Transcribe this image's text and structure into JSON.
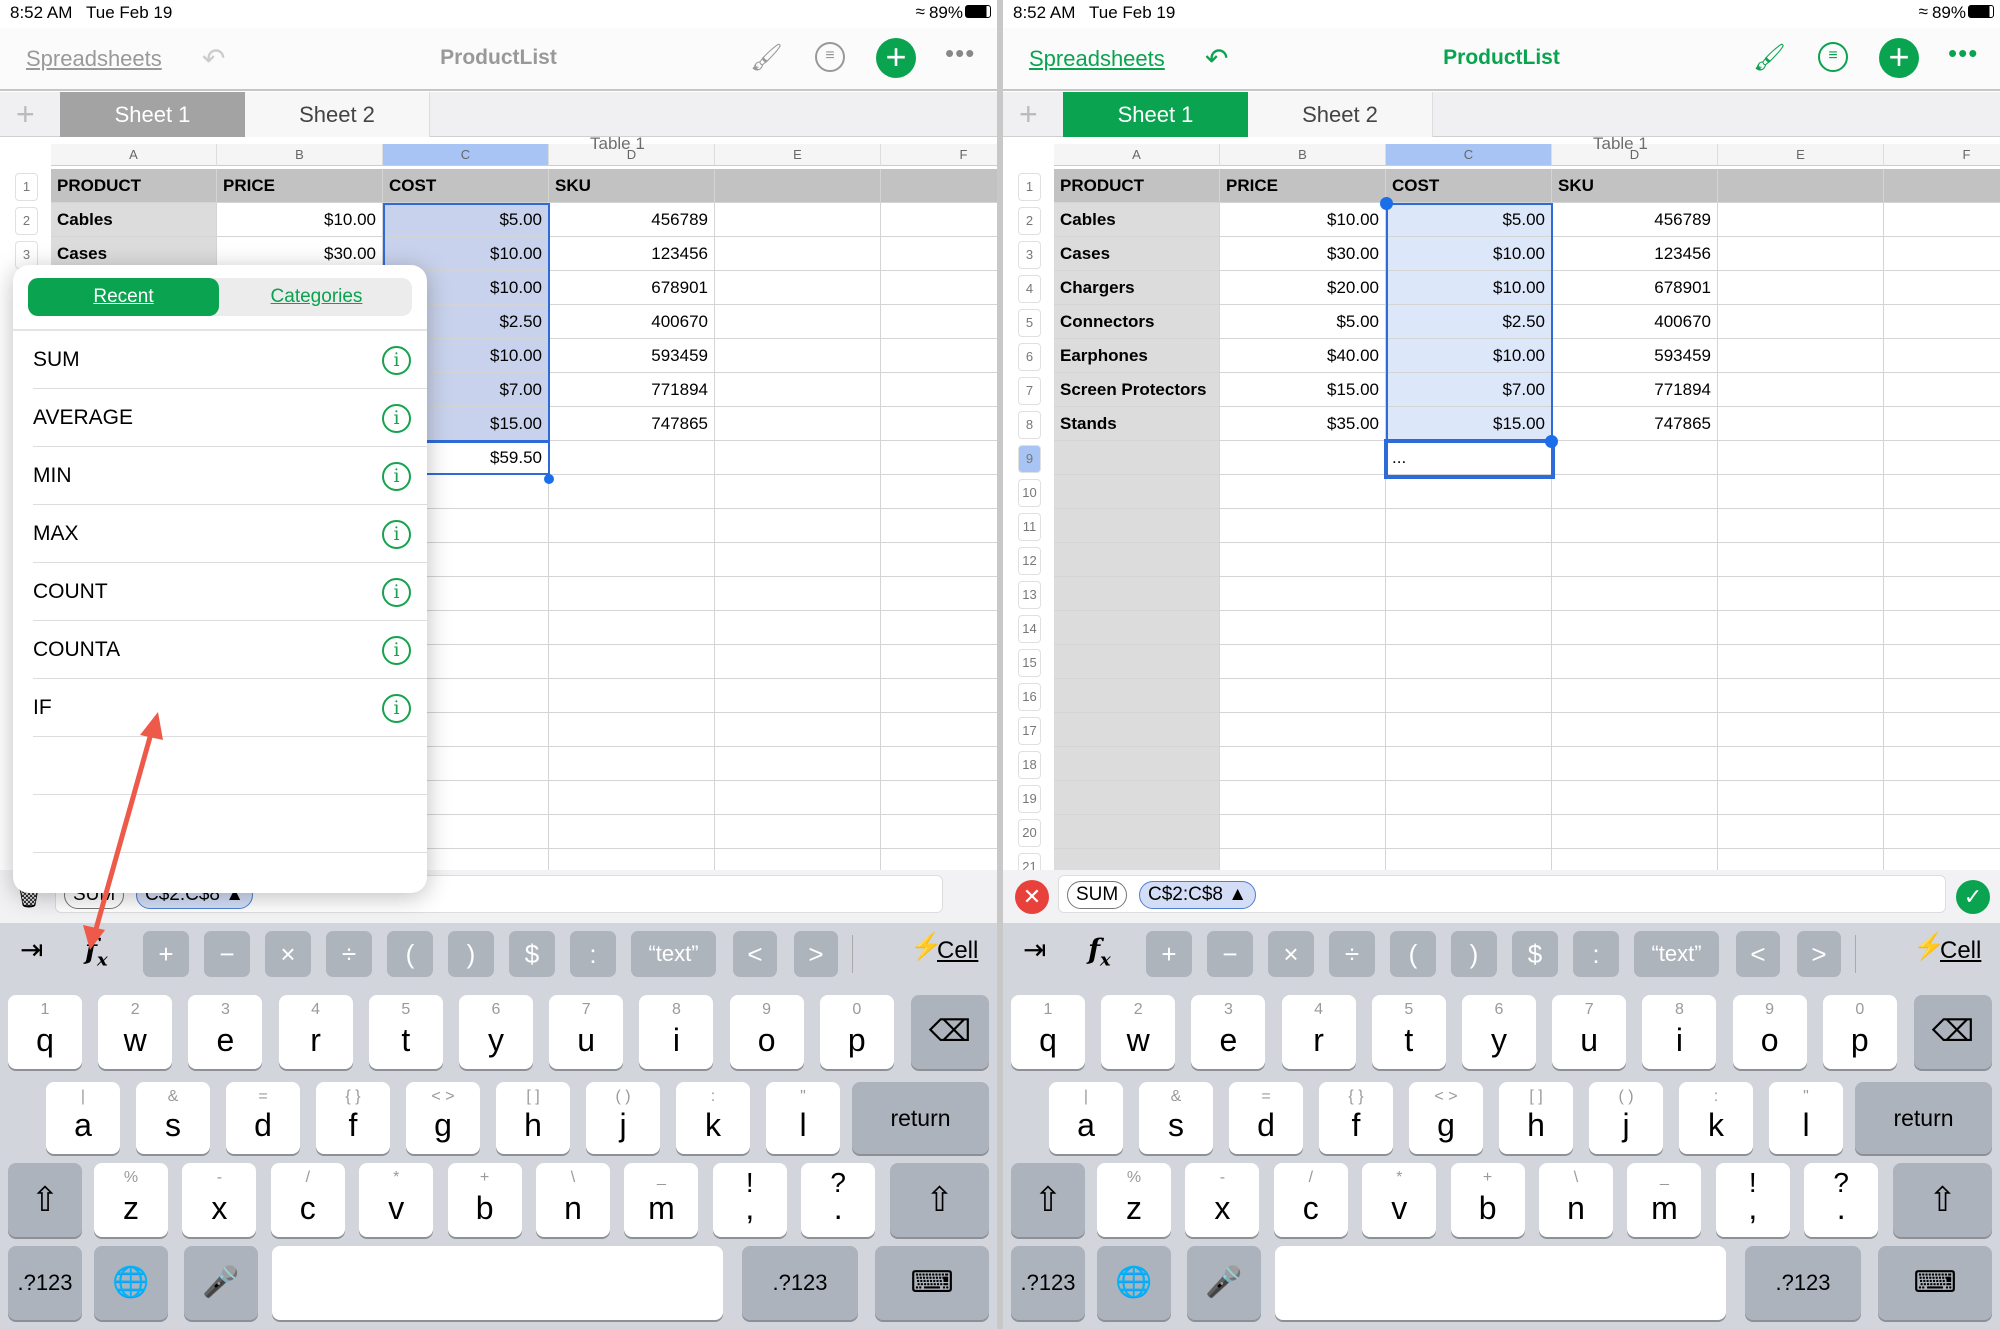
{
  "status": {
    "time": "8:52 AM",
    "date": "Tue Feb 19",
    "battery": "89%"
  },
  "nav": {
    "back": "Spreadsheets",
    "title": "ProductList"
  },
  "tabs": [
    "Sheet 1",
    "Sheet 2"
  ],
  "table": {
    "title": "Table 1",
    "columns": [
      "A",
      "B",
      "C",
      "D",
      "E",
      "F"
    ],
    "header": [
      "PRODUCT",
      "PRICE",
      "COST",
      "SKU"
    ],
    "rows": [
      [
        "Cables",
        "$10.00",
        "$5.00",
        "456789"
      ],
      [
        "Cases",
        "$30.00",
        "$10.00",
        "123456"
      ],
      [
        "Chargers",
        "$20.00",
        "$10.00",
        "678901"
      ],
      [
        "Connectors",
        "$5.00",
        "$2.50",
        "400670"
      ],
      [
        "Earphones",
        "$40.00",
        "$10.00",
        "593459"
      ],
      [
        "Screen Protectors",
        "$15.00",
        "$7.00",
        "771894"
      ],
      [
        "Stands",
        "$35.00",
        "$15.00",
        "747865"
      ]
    ],
    "row_numbers": [
      "1",
      "2",
      "3",
      "4",
      "5",
      "6",
      "7",
      "8",
      "9",
      "10",
      "11",
      "12",
      "13",
      "14",
      "15",
      "16",
      "17",
      "18",
      "19",
      "20",
      "21"
    ]
  },
  "left": {
    "result_cell": "$59.50",
    "formula_func": "SUM",
    "formula_range": "C$2:C$8 ▲",
    "popover": {
      "tabs": [
        "Recent",
        "Categories"
      ],
      "active_tab": "Recent",
      "functions": [
        "SUM",
        "AVERAGE",
        "MIN",
        "MAX",
        "COUNT",
        "COUNTA",
        "IF"
      ]
    }
  },
  "right": {
    "edit_cell": "...",
    "formula_func": "SUM",
    "formula_range": "C$2:C$8 ▲"
  },
  "toolbar": {
    "keys": [
      "+",
      "−",
      "×",
      "÷",
      "(",
      ")",
      "$",
      ":",
      "“text”",
      "<",
      ">"
    ],
    "cell": "Cell"
  },
  "keyboard": {
    "row1": [
      [
        "1",
        "q"
      ],
      [
        "2",
        "w"
      ],
      [
        "3",
        "e"
      ],
      [
        "4",
        "r"
      ],
      [
        "5",
        "t"
      ],
      [
        "6",
        "y"
      ],
      [
        "7",
        "u"
      ],
      [
        "8",
        "i"
      ],
      [
        "9",
        "o"
      ],
      [
        "0",
        "p"
      ]
    ],
    "row2": [
      [
        "|",
        "a"
      ],
      [
        "&",
        "s"
      ],
      [
        "=",
        "d"
      ],
      [
        "{  }",
        "f"
      ],
      [
        "<  >",
        "g"
      ],
      [
        "[  ]",
        "h"
      ],
      [
        "(  )",
        "j"
      ],
      [
        ":",
        "k"
      ],
      [
        "\"",
        "l"
      ]
    ],
    "row3": [
      [
        "%",
        "z"
      ],
      [
        "-",
        "x"
      ],
      [
        "/",
        "c"
      ],
      [
        "*",
        "v"
      ],
      [
        "+",
        "b"
      ],
      [
        "\\",
        "n"
      ],
      [
        "_",
        "m"
      ],
      [
        "!",
        ","
      ],
      [
        "?",
        "."
      ]
    ],
    "return": "return",
    "numbers": ".?123"
  },
  "colors": {
    "accent": "#0aa34f",
    "selection": "#2f6bd8",
    "cancel": "#e8413b"
  }
}
